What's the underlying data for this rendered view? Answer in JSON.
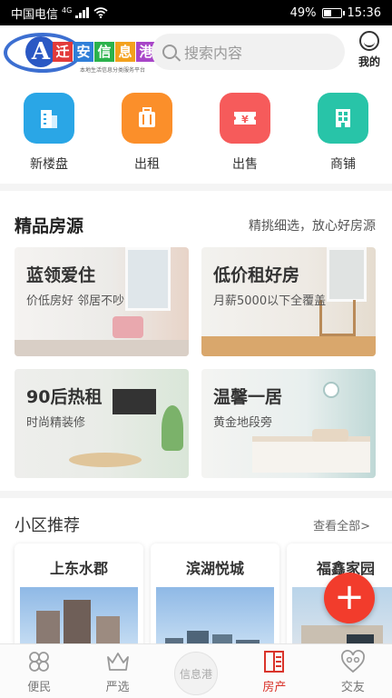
{
  "status_bar": {
    "carrier": "中国电信",
    "network": "4G",
    "battery": "49%",
    "battery_level": 0.49,
    "time": "15:36"
  },
  "header": {
    "logo_letter": "A",
    "logo_title": [
      "迁",
      "安",
      "信",
      "息",
      "港"
    ],
    "logo_subtitle": "本地生活信息分类服务平台",
    "search_placeholder": "搜索内容",
    "mine_label": "我的"
  },
  "categories": [
    {
      "label": "新楼盘",
      "icon": "building-icon",
      "color": "#2aa6e6"
    },
    {
      "label": "出租",
      "icon": "suitcase-icon",
      "color": "#fb8f2a"
    },
    {
      "label": "出售",
      "icon": "ticket-yen-icon",
      "color": "#f65b5b"
    },
    {
      "label": "商铺",
      "icon": "shop-icon",
      "color": "#28c4a8"
    }
  ],
  "premium": {
    "title": "精品房源",
    "subtitle": "精挑细选，放心好房源",
    "tiles": [
      {
        "title": "蓝领爱住",
        "subtitle": "价低房好 邻居不吵"
      },
      {
        "title": "低价租好房",
        "subtitle": "月薪5000以下全覆盖"
      },
      {
        "title": "90后热租",
        "subtitle": "时尚精装修"
      },
      {
        "title": "温馨一居",
        "subtitle": "黄金地段旁"
      }
    ]
  },
  "community": {
    "title": "小区推荐",
    "view_all": "查看全部>",
    "items": [
      {
        "name": "上东水郡"
      },
      {
        "name": "滨湖悦城"
      },
      {
        "name": "福鑫家园"
      }
    ]
  },
  "fab": {
    "label": "+"
  },
  "bottom_nav": [
    {
      "label": "便民",
      "icon": "clover-icon"
    },
    {
      "label": "严选",
      "icon": "crown-icon"
    },
    {
      "label": "信息港",
      "icon": "center-logo"
    },
    {
      "label": "房产",
      "icon": "building-list-icon",
      "active": true
    },
    {
      "label": "交友",
      "icon": "heart-people-icon"
    }
  ],
  "colors": {
    "accent": "#d9342b",
    "fab": "#f23c2c"
  }
}
